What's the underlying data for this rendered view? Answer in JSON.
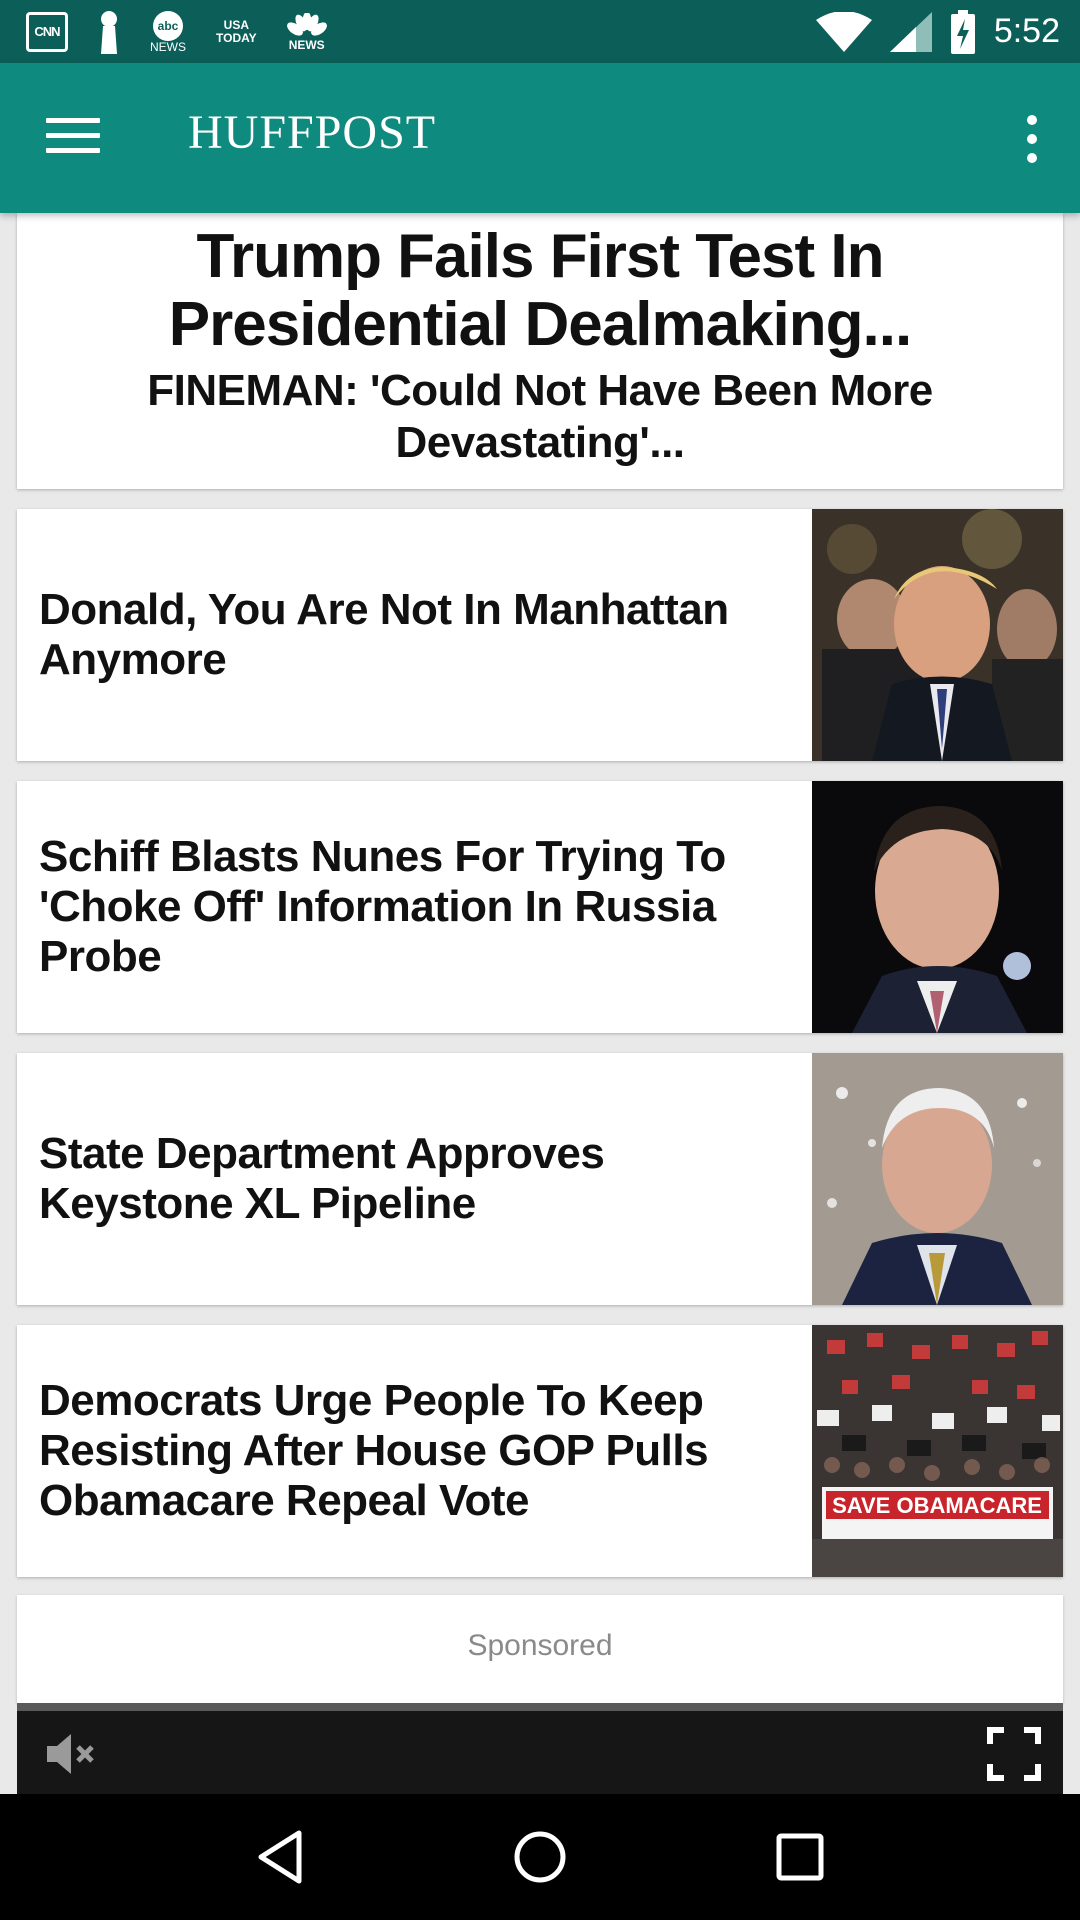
{
  "status_bar": {
    "time": "5:52",
    "notifications": [
      {
        "icon": "cnn-icon",
        "label": "CNN"
      },
      {
        "icon": "keyhole-icon",
        "label": ""
      },
      {
        "icon": "abc-news-icon",
        "label": "abc",
        "sub": "NEWS"
      },
      {
        "icon": "usa-today-icon",
        "label": "USA",
        "sub": "TODAY"
      },
      {
        "icon": "nbc-news-icon",
        "label": "NEWS"
      }
    ]
  },
  "app_bar": {
    "title": "HUFFPOST",
    "menu_icon": "hamburger-menu-icon",
    "overflow_icon": "more-vertical-icon"
  },
  "hero": {
    "title": "Trump Fails First Test In Presidential Dealmaking...",
    "subtitle": "FINEMAN: 'Could Not Have Been More Devastating'..."
  },
  "stories": [
    {
      "title": "Donald, You Are Not In Manhattan Anymore"
    },
    {
      "title": "Schiff Blasts Nunes For Trying To 'Choke Off' Information In Russia Probe"
    },
    {
      "title": "State Department Approves Keystone XL Pipeline"
    },
    {
      "title": "Democrats Urge People To Keep Resisting After House GOP Pulls Obamacare Repeal Vote",
      "image_text": "SAVE OBAMACARE"
    }
  ],
  "sponsored": {
    "label": "Sponsored"
  },
  "video": {
    "mute_icon": "volume-muted-icon",
    "fullscreen_icon": "fullscreen-icon"
  },
  "nav_bar": {
    "back_icon": "back-triangle-icon",
    "home_icon": "home-circle-icon",
    "recents_icon": "recents-square-icon"
  },
  "colors": {
    "status_bar": "#0b5f58",
    "app_bar": "#0f8a7e",
    "background": "#e9e9e9"
  }
}
